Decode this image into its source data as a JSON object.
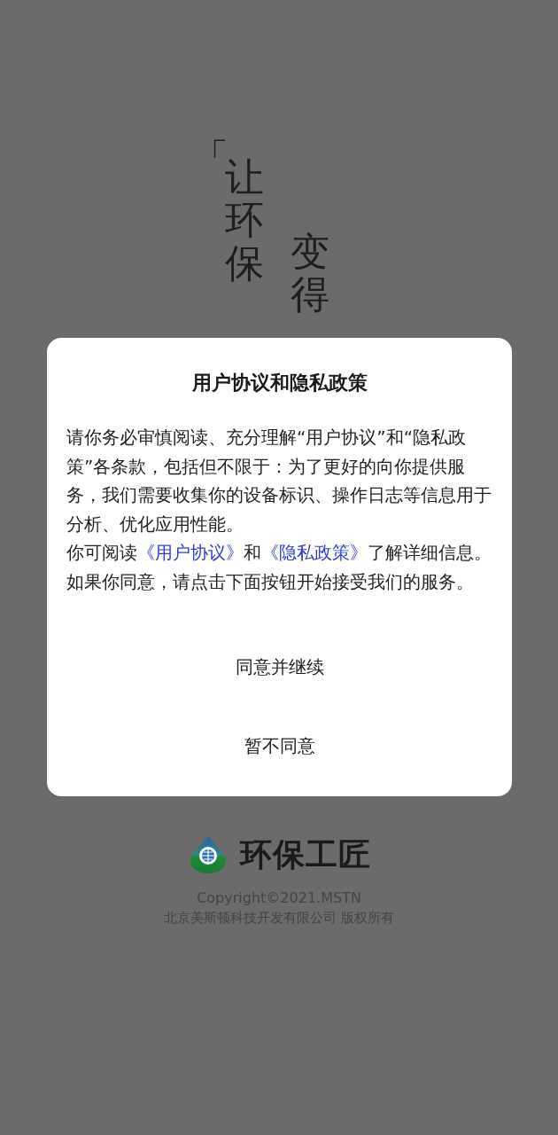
{
  "splash": {
    "slogan_columns": [
      {
        "kind": "bracket",
        "text": "「"
      },
      {
        "kind": "column",
        "text": "让环保"
      },
      {
        "kind": "column",
        "text": "变得"
      }
    ],
    "brand": "环保工匠",
    "copyright": "Copyright©2021.MSTN",
    "company": "北京美斯顿科技开发有限公司 版权所有"
  },
  "dialog": {
    "title": "用户协议和隐私政策",
    "paragraphs": [
      [
        {
          "kind": "text",
          "text": "请你务必审慎阅读、充分理解“用户协议”和“隐私政策”各条款，包括但不限于：为了更好的向你提供服务，我们需要收集你的设备标识、操作日志等信息用于分析、优化应用性能。"
        }
      ],
      [
        {
          "kind": "text",
          "text": "你可阅读"
        },
        {
          "kind": "link",
          "text": "《用户协议》"
        },
        {
          "kind": "text",
          "text": "和"
        },
        {
          "kind": "link",
          "text": "《隐私政策》"
        },
        {
          "kind": "text",
          "text": "了解详细信息。如果你同意，请点击下面按钮开始接受我们的服务。"
        }
      ]
    ],
    "buttons": [
      "同意并继续",
      "暂不同意"
    ]
  }
}
